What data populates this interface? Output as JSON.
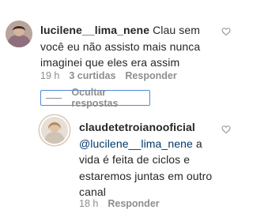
{
  "comments": [
    {
      "username": "lucilene__lima_nene",
      "text": "Clau sem você eu não assisto mais nunca imaginei que eles era assim",
      "time": "19 h",
      "likes": "3 curtidas",
      "reply_label": "Responder"
    },
    {
      "username": "claudetetroianooficial",
      "mention": "@lucilene__lima_nene",
      "text": "a vida é feita de ciclos e estaremos juntas em outro canal",
      "time": "18 h",
      "reply_label": "Responder"
    }
  ],
  "hide_replies_label": "Ocultar respostas",
  "colors": {
    "mention": "#00376b",
    "meta": "#8e8e8e",
    "focus": "#4f8ad9"
  },
  "icons": [
    "heart-icon",
    "avatar"
  ]
}
